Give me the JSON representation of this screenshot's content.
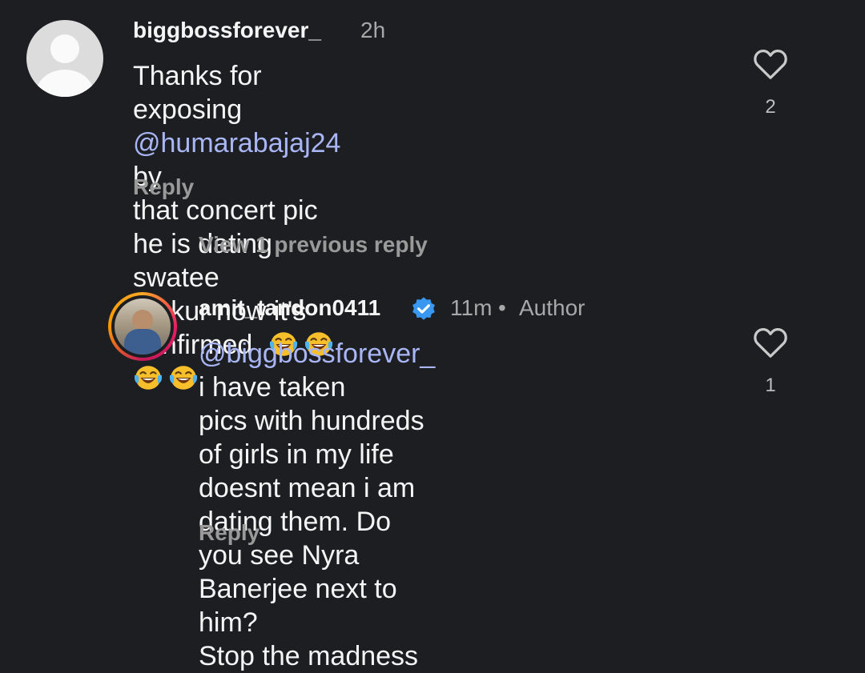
{
  "comments": [
    {
      "username": "biggbossforever_",
      "time": "2h",
      "text_before": "Thanks for exposing ",
      "mention": "@humarabajaj24",
      "text_after_line1": " by",
      "line2": "that concert pic he is dating swatee",
      "line3": "thakur now it's confirmed",
      "emoji_icon": "face-with-tears-of-joy-icon",
      "emoji_count": 4,
      "likes": "2",
      "reply_label": "Reply"
    },
    {
      "username": "amit_tandon0411",
      "verified": true,
      "time": "11m",
      "separator": "•",
      "role": "Author",
      "mention": "@biggbossforever_",
      "line1_rest": " i have taken",
      "line2": "pics with hundreds of girls in my life",
      "line3": "doesnt mean i am dating them.  Do",
      "line4": "you see Nyra Banerjee next to him?",
      "line5": "Stop the madness",
      "likes": "1",
      "reply_label": "Reply"
    }
  ],
  "thread": {
    "view_previous_label": "View 1 previous reply"
  },
  "colors": {
    "background": "#1d1e22",
    "mention": "#a9b6f5",
    "verified": "#3897f0"
  }
}
